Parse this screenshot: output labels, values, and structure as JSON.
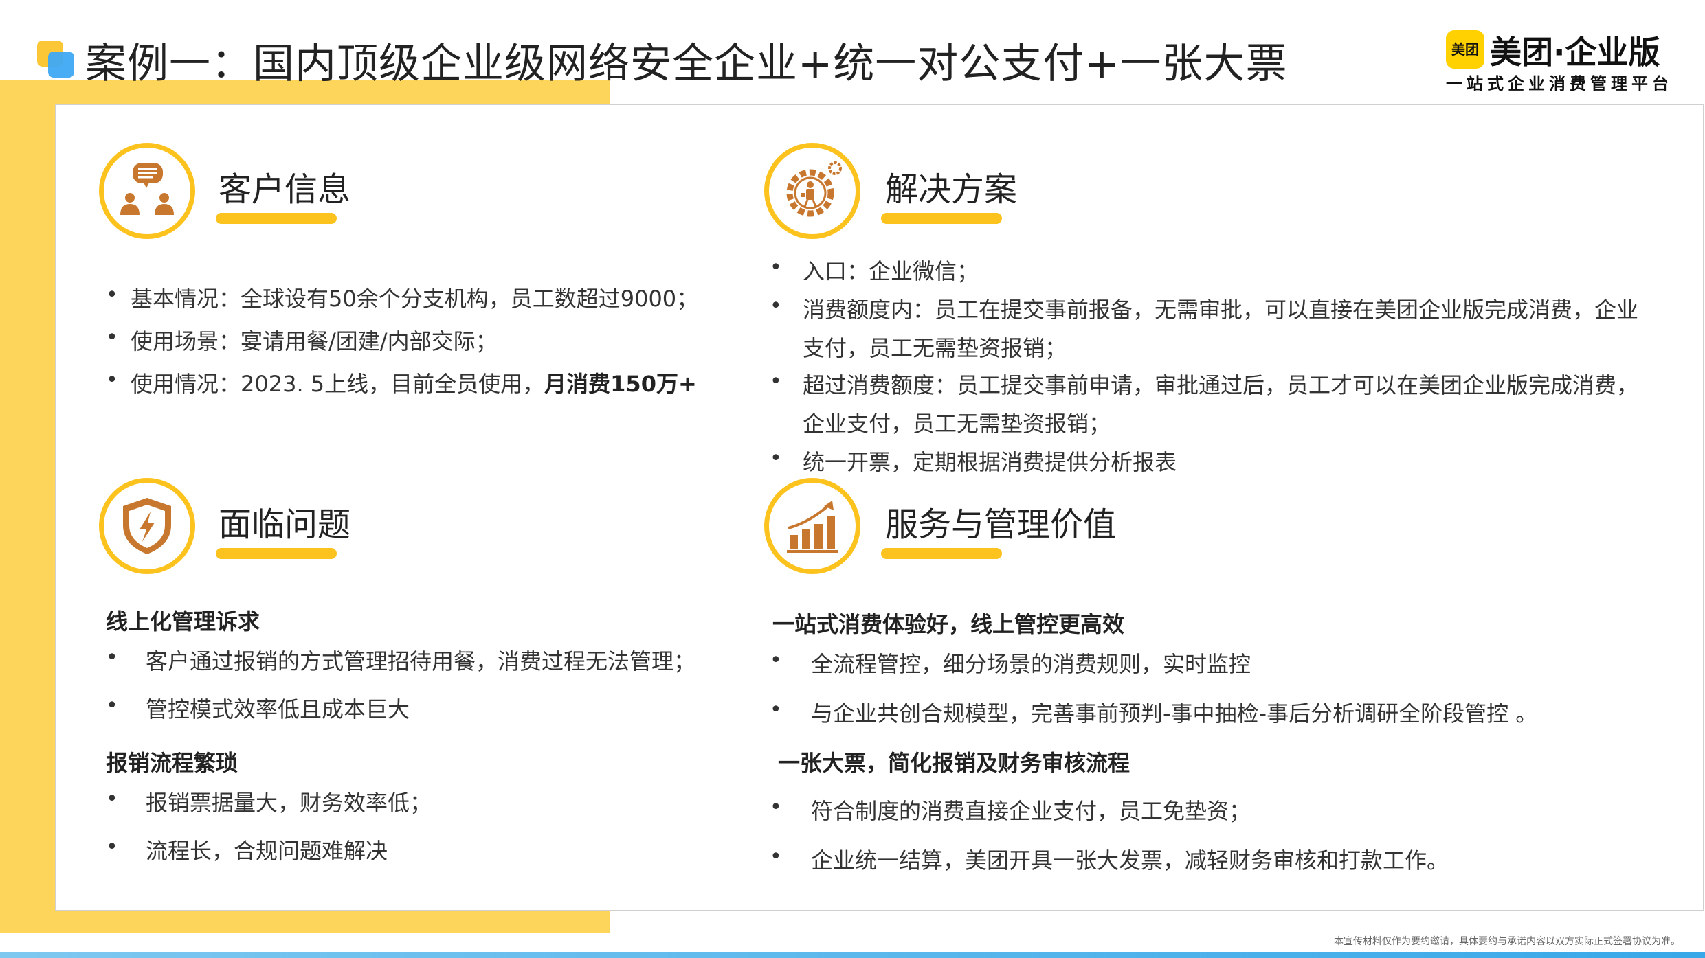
{
  "page": {
    "title": "案例一：国内顶级企业级网络安全企业+统一对公支付+一张大票",
    "footnote": "本宣传材料仅作为要约邀请，具体要约与承诺内容以双方实际正式签署协议为准。"
  },
  "logo": {
    "badge": "美团",
    "name": "美团·企业版",
    "tagline": "一站式企业消费管理平台"
  },
  "sections": {
    "customer": {
      "icon": "chat-people-icon",
      "title": "客户信息",
      "items": [
        "基本情况：全球设有50余个分支机构，员工数超过9000；",
        "使用场景：宴请用餐/团建/内部交际；",
        "使用情况：2023. 5上线，目前全员使用，"
      ],
      "item3_bold": "月消费150万+"
    },
    "solution": {
      "icon": "gear-person-icon",
      "title": "解决方案",
      "items": [
        "入口：企业微信；",
        "消费额度内：员工在提交事前报备，无需审批，可以直接在美团企业版完成消费，企业",
        "支付，员工无需垫资报销；",
        "超过消费额度：员工提交事前申请，审批通过后，员工才可以在美团企业版完成消费，",
        "企业支付，员工无需垫资报销；",
        "统一开票，定期根据消费提供分析报表"
      ]
    },
    "problems": {
      "icon": "shield-lightning-icon",
      "title": "面临问题",
      "group1_title": "线上化管理诉求",
      "group1_items": [
        "客户通过报销的方式管理招待用餐，消费过程无法管理；",
        "管控模式效率低且成本巨大"
      ],
      "group2_title": "报销流程繁琐",
      "group2_items": [
        "报销票据量大，财务效率低；",
        "流程长，合规问题难解决"
      ]
    },
    "value": {
      "icon": "bar-chart-growth-icon",
      "title": "服务与管理价值",
      "group1_title": "一站式消费体验好，线上管控更高效",
      "group1_items": [
        "全流程管控，细分场景的消费规则，实时监控",
        "与企业共创合规模型，完善事前预判-事中抽检-事后分析调研全阶段管控 。"
      ],
      "group2_title": "一张大票，简化报销及财务审核流程",
      "group2_items": [
        "符合制度的消费直接企业支付，员工免垫资；",
        "企业统一结算，美团开具一张大发票，减轻财务审核和打款工作。"
      ]
    }
  },
  "bullet": "•",
  "colors": {
    "accent_yellow": "#FCC21E",
    "panel_yellow": "#FDD55A",
    "icon_brown": "#C8772E",
    "bottom_blue": "#38A8E8"
  }
}
